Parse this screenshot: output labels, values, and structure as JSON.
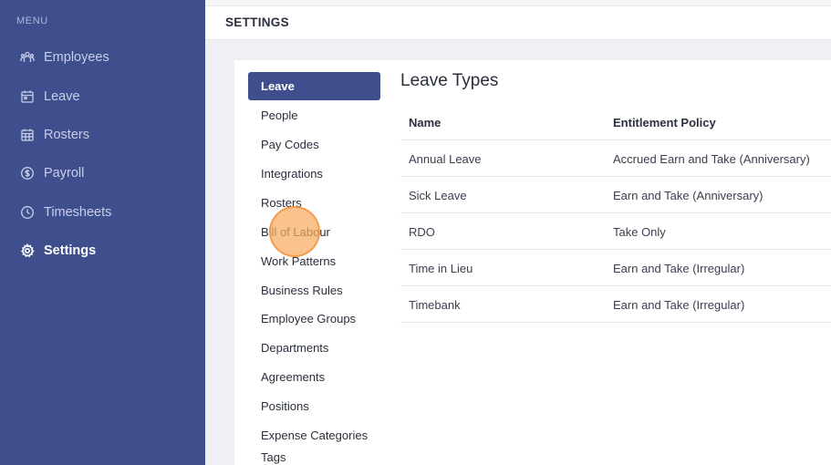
{
  "sidebar": {
    "menu_label": "MENU",
    "items": [
      {
        "label": "Employees",
        "icon": "users-icon"
      },
      {
        "label": "Leave",
        "icon": "calendar-icon"
      },
      {
        "label": "Rosters",
        "icon": "calendar-grid-icon"
      },
      {
        "label": "Payroll",
        "icon": "dollar-icon"
      },
      {
        "label": "Timesheets",
        "icon": "clock-icon"
      },
      {
        "label": "Settings",
        "icon": "gear-icon"
      }
    ],
    "active": "Settings"
  },
  "header": {
    "title": "SETTINGS"
  },
  "settings_nav": {
    "items": [
      "Leave",
      "People",
      "Pay Codes",
      "Integrations",
      "Rosters",
      "Bill of Labour",
      "Work Patterns",
      "Business Rules",
      "Employee Groups",
      "Departments",
      "Agreements",
      "Positions",
      "Expense Categories",
      "Tags"
    ],
    "active": "Leave"
  },
  "leave_types": {
    "title": "Leave Types",
    "columns": [
      "Name",
      "Entitlement Policy"
    ],
    "rows": [
      {
        "name": "Annual Leave",
        "policy": "Accrued Earn and Take (Anniversary)"
      },
      {
        "name": "Sick Leave",
        "policy": "Earn and Take (Anniversary)"
      },
      {
        "name": "RDO",
        "policy": "Take Only"
      },
      {
        "name": "Time in Lieu",
        "policy": "Earn and Take (Irregular)"
      },
      {
        "name": "Timebank",
        "policy": "Earn and Take (Irregular)"
      }
    ]
  },
  "colors": {
    "sidebar_bg": "#3f4e8c",
    "accent": "#3f4e8c",
    "click_indicator": "#f8aa5f"
  }
}
